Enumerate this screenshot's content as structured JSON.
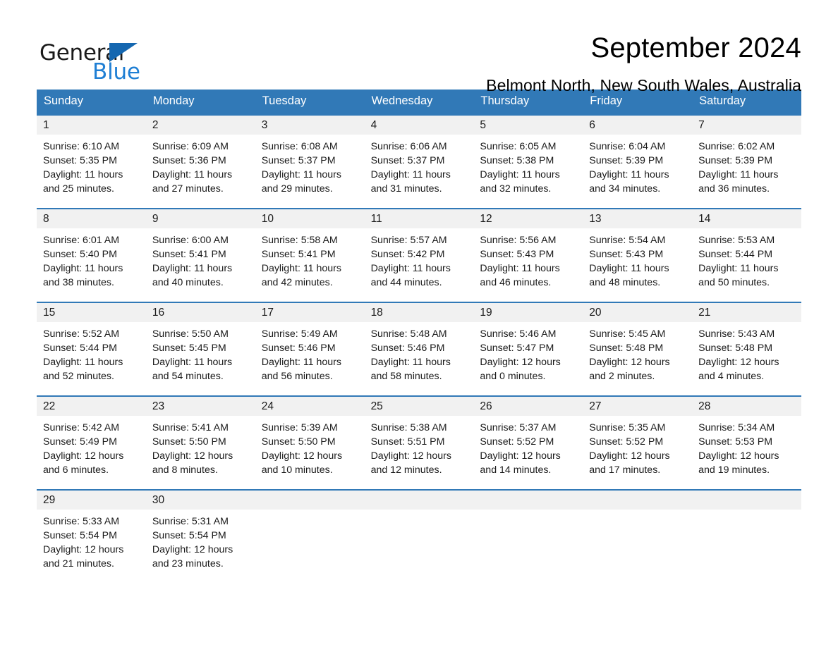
{
  "logo": {
    "word_general": "General",
    "word_blue": "Blue",
    "triangle_color": "#1567b0",
    "blue_text_color": "#1f7fd4"
  },
  "header": {
    "month_title": "September 2024",
    "location": "Belmont North, New South Wales, Australia"
  },
  "theme": {
    "header_blue": "#3179b7",
    "day_number_bg": "#f1f1f1",
    "cell_bg": "#ffffff",
    "text_color": "#1a1a1a"
  },
  "weekdays": [
    "Sunday",
    "Monday",
    "Tuesday",
    "Wednesday",
    "Thursday",
    "Friday",
    "Saturday"
  ],
  "labels": {
    "sunrise_prefix": "Sunrise:",
    "sunset_prefix": "Sunset:",
    "daylight_prefix": "Daylight:"
  },
  "weeks": [
    [
      {
        "day": "1",
        "sunrise": "Sunrise: 6:10 AM",
        "sunset": "Sunset: 5:35 PM",
        "daylight_l1": "Daylight: 11 hours",
        "daylight_l2": "and 25 minutes."
      },
      {
        "day": "2",
        "sunrise": "Sunrise: 6:09 AM",
        "sunset": "Sunset: 5:36 PM",
        "daylight_l1": "Daylight: 11 hours",
        "daylight_l2": "and 27 minutes."
      },
      {
        "day": "3",
        "sunrise": "Sunrise: 6:08 AM",
        "sunset": "Sunset: 5:37 PM",
        "daylight_l1": "Daylight: 11 hours",
        "daylight_l2": "and 29 minutes."
      },
      {
        "day": "4",
        "sunrise": "Sunrise: 6:06 AM",
        "sunset": "Sunset: 5:37 PM",
        "daylight_l1": "Daylight: 11 hours",
        "daylight_l2": "and 31 minutes."
      },
      {
        "day": "5",
        "sunrise": "Sunrise: 6:05 AM",
        "sunset": "Sunset: 5:38 PM",
        "daylight_l1": "Daylight: 11 hours",
        "daylight_l2": "and 32 minutes."
      },
      {
        "day": "6",
        "sunrise": "Sunrise: 6:04 AM",
        "sunset": "Sunset: 5:39 PM",
        "daylight_l1": "Daylight: 11 hours",
        "daylight_l2": "and 34 minutes."
      },
      {
        "day": "7",
        "sunrise": "Sunrise: 6:02 AM",
        "sunset": "Sunset: 5:39 PM",
        "daylight_l1": "Daylight: 11 hours",
        "daylight_l2": "and 36 minutes."
      }
    ],
    [
      {
        "day": "8",
        "sunrise": "Sunrise: 6:01 AM",
        "sunset": "Sunset: 5:40 PM",
        "daylight_l1": "Daylight: 11 hours",
        "daylight_l2": "and 38 minutes."
      },
      {
        "day": "9",
        "sunrise": "Sunrise: 6:00 AM",
        "sunset": "Sunset: 5:41 PM",
        "daylight_l1": "Daylight: 11 hours",
        "daylight_l2": "and 40 minutes."
      },
      {
        "day": "10",
        "sunrise": "Sunrise: 5:58 AM",
        "sunset": "Sunset: 5:41 PM",
        "daylight_l1": "Daylight: 11 hours",
        "daylight_l2": "and 42 minutes."
      },
      {
        "day": "11",
        "sunrise": "Sunrise: 5:57 AM",
        "sunset": "Sunset: 5:42 PM",
        "daylight_l1": "Daylight: 11 hours",
        "daylight_l2": "and 44 minutes."
      },
      {
        "day": "12",
        "sunrise": "Sunrise: 5:56 AM",
        "sunset": "Sunset: 5:43 PM",
        "daylight_l1": "Daylight: 11 hours",
        "daylight_l2": "and 46 minutes."
      },
      {
        "day": "13",
        "sunrise": "Sunrise: 5:54 AM",
        "sunset": "Sunset: 5:43 PM",
        "daylight_l1": "Daylight: 11 hours",
        "daylight_l2": "and 48 minutes."
      },
      {
        "day": "14",
        "sunrise": "Sunrise: 5:53 AM",
        "sunset": "Sunset: 5:44 PM",
        "daylight_l1": "Daylight: 11 hours",
        "daylight_l2": "and 50 minutes."
      }
    ],
    [
      {
        "day": "15",
        "sunrise": "Sunrise: 5:52 AM",
        "sunset": "Sunset: 5:44 PM",
        "daylight_l1": "Daylight: 11 hours",
        "daylight_l2": "and 52 minutes."
      },
      {
        "day": "16",
        "sunrise": "Sunrise: 5:50 AM",
        "sunset": "Sunset: 5:45 PM",
        "daylight_l1": "Daylight: 11 hours",
        "daylight_l2": "and 54 minutes."
      },
      {
        "day": "17",
        "sunrise": "Sunrise: 5:49 AM",
        "sunset": "Sunset: 5:46 PM",
        "daylight_l1": "Daylight: 11 hours",
        "daylight_l2": "and 56 minutes."
      },
      {
        "day": "18",
        "sunrise": "Sunrise: 5:48 AM",
        "sunset": "Sunset: 5:46 PM",
        "daylight_l1": "Daylight: 11 hours",
        "daylight_l2": "and 58 minutes."
      },
      {
        "day": "19",
        "sunrise": "Sunrise: 5:46 AM",
        "sunset": "Sunset: 5:47 PM",
        "daylight_l1": "Daylight: 12 hours",
        "daylight_l2": "and 0 minutes."
      },
      {
        "day": "20",
        "sunrise": "Sunrise: 5:45 AM",
        "sunset": "Sunset: 5:48 PM",
        "daylight_l1": "Daylight: 12 hours",
        "daylight_l2": "and 2 minutes."
      },
      {
        "day": "21",
        "sunrise": "Sunrise: 5:43 AM",
        "sunset": "Sunset: 5:48 PM",
        "daylight_l1": "Daylight: 12 hours",
        "daylight_l2": "and 4 minutes."
      }
    ],
    [
      {
        "day": "22",
        "sunrise": "Sunrise: 5:42 AM",
        "sunset": "Sunset: 5:49 PM",
        "daylight_l1": "Daylight: 12 hours",
        "daylight_l2": "and 6 minutes."
      },
      {
        "day": "23",
        "sunrise": "Sunrise: 5:41 AM",
        "sunset": "Sunset: 5:50 PM",
        "daylight_l1": "Daylight: 12 hours",
        "daylight_l2": "and 8 minutes."
      },
      {
        "day": "24",
        "sunrise": "Sunrise: 5:39 AM",
        "sunset": "Sunset: 5:50 PM",
        "daylight_l1": "Daylight: 12 hours",
        "daylight_l2": "and 10 minutes."
      },
      {
        "day": "25",
        "sunrise": "Sunrise: 5:38 AM",
        "sunset": "Sunset: 5:51 PM",
        "daylight_l1": "Daylight: 12 hours",
        "daylight_l2": "and 12 minutes."
      },
      {
        "day": "26",
        "sunrise": "Sunrise: 5:37 AM",
        "sunset": "Sunset: 5:52 PM",
        "daylight_l1": "Daylight: 12 hours",
        "daylight_l2": "and 14 minutes."
      },
      {
        "day": "27",
        "sunrise": "Sunrise: 5:35 AM",
        "sunset": "Sunset: 5:52 PM",
        "daylight_l1": "Daylight: 12 hours",
        "daylight_l2": "and 17 minutes."
      },
      {
        "day": "28",
        "sunrise": "Sunrise: 5:34 AM",
        "sunset": "Sunset: 5:53 PM",
        "daylight_l1": "Daylight: 12 hours",
        "daylight_l2": "and 19 minutes."
      }
    ],
    [
      {
        "day": "29",
        "sunrise": "Sunrise: 5:33 AM",
        "sunset": "Sunset: 5:54 PM",
        "daylight_l1": "Daylight: 12 hours",
        "daylight_l2": "and 21 minutes."
      },
      {
        "day": "30",
        "sunrise": "Sunrise: 5:31 AM",
        "sunset": "Sunset: 5:54 PM",
        "daylight_l1": "Daylight: 12 hours",
        "daylight_l2": "and 23 minutes."
      },
      {
        "day": "",
        "sunrise": "",
        "sunset": "",
        "daylight_l1": "",
        "daylight_l2": ""
      },
      {
        "day": "",
        "sunrise": "",
        "sunset": "",
        "daylight_l1": "",
        "daylight_l2": ""
      },
      {
        "day": "",
        "sunrise": "",
        "sunset": "",
        "daylight_l1": "",
        "daylight_l2": ""
      },
      {
        "day": "",
        "sunrise": "",
        "sunset": "",
        "daylight_l1": "",
        "daylight_l2": ""
      },
      {
        "day": "",
        "sunrise": "",
        "sunset": "",
        "daylight_l1": "",
        "daylight_l2": ""
      }
    ]
  ]
}
